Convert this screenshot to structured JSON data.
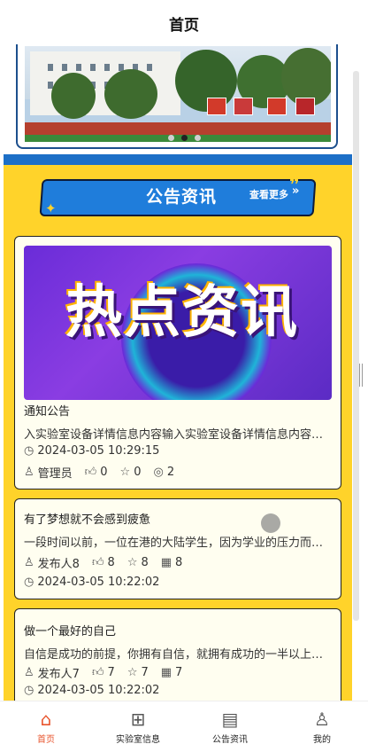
{
  "navbar": {
    "title": "首页"
  },
  "banner": {
    "slides": 3,
    "active_index": 1
  },
  "notice_section": {
    "title": "公告资讯",
    "more": "查看更多",
    "more_arrow": "»"
  },
  "featured": {
    "image_text": "热点资讯",
    "title": "通知公告",
    "description": "入实验室设备详情信息内容输入实验室设备详情信息内容输入实验室设备详情信息内容",
    "time": "2024-03-05 10:29:15",
    "author": "管理员",
    "likes": "0",
    "favorites": "0",
    "views": "2"
  },
  "articles": [
    {
      "title": "有了梦想就不会感到疲惫",
      "description": "一段时间以前，一位在港的大陆学生，因为学业的压力而感到疲惫",
      "author": "发布人8",
      "likes": "8",
      "favorites": "8",
      "views": "8",
      "time": "2024-03-05 10:22:02"
    },
    {
      "title": "做一个最好的自己",
      "description": "自信是成功的前提，你拥有自信，就拥有成功的一半以上的机会",
      "author": "发布人7",
      "likes": "7",
      "favorites": "7",
      "views": "7",
      "time": "2024-03-05 10:22:02"
    }
  ],
  "tabbar": {
    "tabs": [
      {
        "label": "首页",
        "icon": "home-icon",
        "active": true
      },
      {
        "label": "实验室信息",
        "icon": "grid-icon",
        "active": false
      },
      {
        "label": "公告资讯",
        "icon": "news-icon",
        "active": false
      },
      {
        "label": "我的",
        "icon": "user-icon",
        "active": false
      }
    ]
  },
  "colors": {
    "accent": "#e8552e",
    "section_bg": "#ffd32a",
    "section_head": "#1f7ddb"
  }
}
